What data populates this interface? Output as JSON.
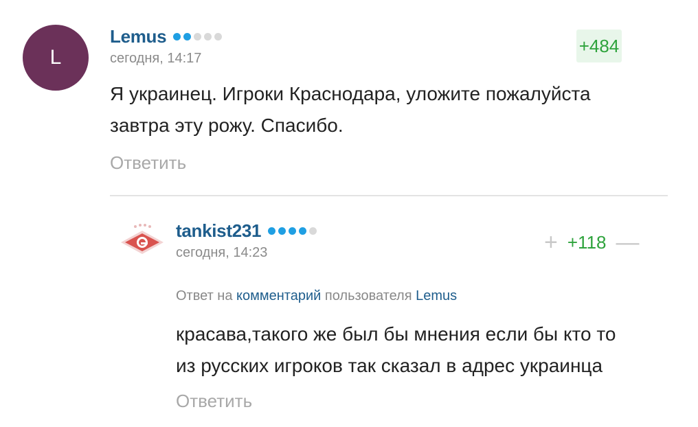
{
  "comment1": {
    "avatar_letter": "L",
    "username": "Lemus",
    "rating_dots": [
      true,
      true,
      false,
      false,
      false
    ],
    "timestamp": "сегодня, 14:17",
    "score": "+484",
    "text_line1": "Я украинец. Игроки Краснодара, уложите пожалуйста",
    "text_line2": "завтра эту рожу. Спасибо.",
    "reply_label": "Ответить"
  },
  "comment2": {
    "avatar_icon": "spartak-logo-icon",
    "username": "tankist231",
    "rating_dots": [
      true,
      true,
      true,
      true,
      false
    ],
    "timestamp": "сегодня, 14:23",
    "vote_plus": "+",
    "score": "+118",
    "vote_minus": "—",
    "reply_prefix": "Ответ на",
    "reply_comment_link": "комментарий",
    "reply_middle": "пользователя",
    "reply_user_link": "Lemus",
    "text_line1": "красава,такого же был бы мнения если бы кто то",
    "text_line2": "из русских игроков так сказал в адрес украинца",
    "reply_label": "Ответить"
  },
  "colors": {
    "username": "#1e5d8c",
    "score_positive": "#2ea33c",
    "avatar_bg": "#6b3159",
    "dot_active": "#1f9fe3"
  }
}
